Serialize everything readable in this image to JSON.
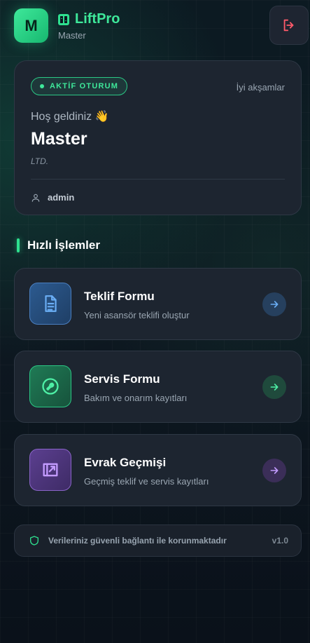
{
  "header": {
    "avatar_letter": "M",
    "app_name": "LiftPro",
    "subtitle": "Master",
    "logout_icon": "logout-icon"
  },
  "session": {
    "badge": "AKTİF OTURUM",
    "greeting_time": "İyi akşamlar",
    "welcome": "Hoş geldiniz 👋",
    "name": "Master",
    "company": "LTD.",
    "username": "admin"
  },
  "quick_actions": {
    "title": "Hızlı İşlemler",
    "items": [
      {
        "title": "Teklif Formu",
        "subtitle": "Yeni asansör teklifi oluştur",
        "icon": "document-icon",
        "color": "#4a90e2"
      },
      {
        "title": "Servis Formu",
        "subtitle": "Bakım ve onarım kayıtları",
        "icon": "wrench-icon",
        "color": "#2ee08f"
      },
      {
        "title": "Evrak Geçmişi",
        "subtitle": "Geçmiş teklif ve servis kayıtları",
        "icon": "history-icon",
        "color": "#a070e0"
      }
    ]
  },
  "footer": {
    "text": "Verileriniz güvenli bağlantı ile korunmaktadır",
    "version": "v1.0"
  },
  "colors": {
    "accent": "#2ee08f",
    "background": "#0b1620",
    "card": "#1d2530",
    "logout": "#ff5a6a"
  }
}
